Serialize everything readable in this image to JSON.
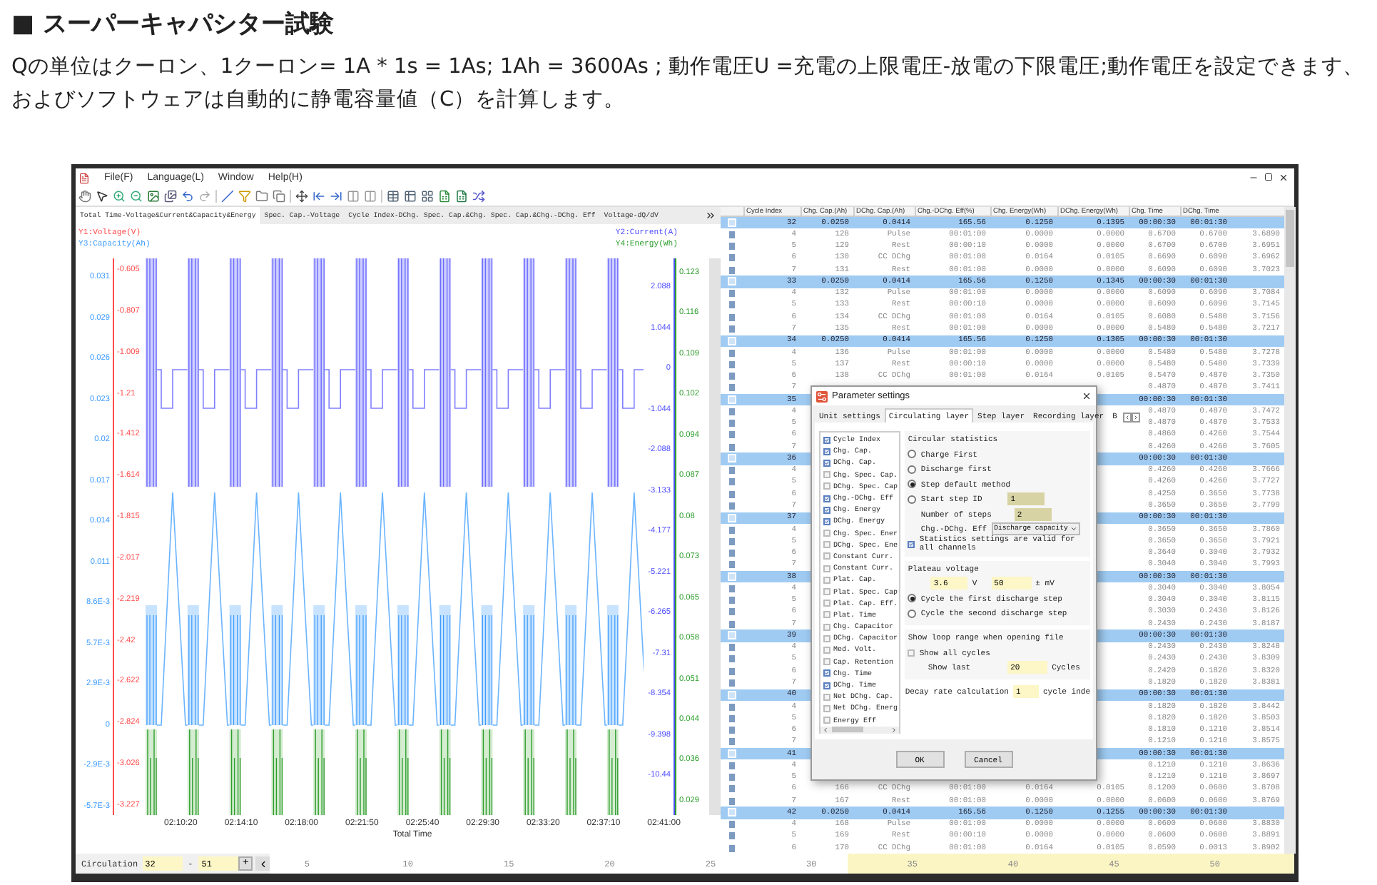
{
  "heading": "■ スーパーキャパシター試験",
  "paragraph": "Qの単位はクーロン、1クーロン= 1A * 1s = 1As; 1Ah = 3600As ; 動作電圧U =充電の上限電圧-放電の下限電圧;動作電圧を設定できます、およびソフトウェアは自動的に静電容量値（C）を計算します。",
  "menu": [
    "File(F)",
    "Language(L)",
    "Window",
    "Help(H)"
  ],
  "chart_tabs": [
    {
      "label": "Total Time-Voltage&Current&Capacity&Energy",
      "selected": true
    },
    {
      "label": "Spec. Cap.-Voltage",
      "selected": false
    },
    {
      "label": "Cycle Index-DChg. Spec. Cap.&Chg. Spec. Cap.&Chg.-DChg. Eff",
      "selected": false
    },
    {
      "label": "Voltage-dQ/dV",
      "selected": false
    }
  ],
  "chart": {
    "legend_left": [
      {
        "text": "Y1:Voltage(V)",
        "color": "#ff4d4d"
      },
      {
        "text": "Y3:Capacity(Ah)",
        "color": "#3d9bff"
      }
    ],
    "legend_right": [
      {
        "text": "Y2:Current(A)",
        "color": "#5050ff"
      },
      {
        "text": "Y4:Energy(Wh)",
        "color": "#2e9e2e"
      }
    ],
    "y3_ticks": [
      "0.031",
      "0.029",
      "0.026",
      "0.023",
      "0.02",
      "0.017",
      "0.014",
      "0.011",
      "8.6E-3",
      "5.7E-3",
      "2.9E-3",
      "0",
      "-2.9E-3",
      "-5.7E-3"
    ],
    "y1_ticks": [
      "-0.605",
      "-0.807",
      "-1.009",
      "-1.21",
      "-1.412",
      "-1.614",
      "-1.815",
      "-2.017",
      "-2.219",
      "-2.42",
      "-2.622",
      "-2.824",
      "-3.026",
      "-3.227"
    ],
    "y2_ticks": [
      "2.088",
      "1.044",
      "0",
      "-1.044",
      "-2.088",
      "-3.133",
      "-4.177",
      "-5.221",
      "-6.265",
      "-7.31",
      "-8.354",
      "-9.398",
      "-10.44"
    ],
    "y4_ticks": [
      "0.123",
      "0.116",
      "0.109",
      "0.102",
      "0.094",
      "0.087",
      "0.08",
      "0.073",
      "0.065",
      "0.058",
      "0.051",
      "0.044",
      "0.036",
      "0.029"
    ],
    "x_ticks": [
      "02:10:20",
      "02:14:10",
      "02:18:00",
      "02:21:50",
      "02:25:40",
      "02:29:30",
      "02:33:20",
      "02:37:10",
      "02:41:00"
    ],
    "x_title": "Total Time"
  },
  "table": {
    "columns": [
      "Cycle Index",
      "Chg. Cap.(Ah)",
      "DChg. Cap.(Ah)",
      "Chg.-DChg. Eff(%)",
      "Chg. Energy(Wh)",
      "DChg. Energy(Wh)",
      "Chg. Time",
      "DChg. Time"
    ],
    "rows": [
      {
        "kind": "cycle",
        "cells": [
          "32",
          "0.0250",
          "0.0414",
          "165.56",
          "0.1250",
          "0.1395",
          "00:00:30",
          "00:01:30"
        ]
      },
      {
        "kind": "step",
        "cells": [
          "4",
          "128",
          "Pulse",
          "00:01:00",
          "0.0000",
          "0.0000",
          "0.6700",
          "0.6700",
          "3.6890"
        ]
      },
      {
        "kind": "step",
        "cells": [
          "5",
          "129",
          "Rest",
          "00:00:10",
          "0.0000",
          "0.0000",
          "0.6700",
          "0.6700",
          "3.6951"
        ]
      },
      {
        "kind": "step",
        "cells": [
          "6",
          "130",
          "CC DChg",
          "00:01:00",
          "0.0164",
          "0.0105",
          "0.6690",
          "0.6090",
          "3.6962"
        ]
      },
      {
        "kind": "step",
        "cells": [
          "7",
          "131",
          "Rest",
          "00:01:00",
          "0.0000",
          "0.0000",
          "0.6090",
          "0.6090",
          "3.7023"
        ]
      },
      {
        "kind": "cycle",
        "cells": [
          "33",
          "0.0250",
          "0.0414",
          "165.56",
          "0.1250",
          "0.1345",
          "00:00:30",
          "00:01:30"
        ]
      },
      {
        "kind": "step",
        "cells": [
          "4",
          "132",
          "Pulse",
          "00:01:00",
          "0.0000",
          "0.0000",
          "0.6090",
          "0.6090",
          "3.7084"
        ]
      },
      {
        "kind": "step",
        "cells": [
          "5",
          "133",
          "Rest",
          "00:00:10",
          "0.0000",
          "0.0000",
          "0.6090",
          "0.6090",
          "3.7145"
        ]
      },
      {
        "kind": "step",
        "cells": [
          "6",
          "134",
          "CC DChg",
          "00:01:00",
          "0.0164",
          "0.0105",
          "0.6080",
          "0.5480",
          "3.7156"
        ]
      },
      {
        "kind": "step",
        "cells": [
          "7",
          "135",
          "Rest",
          "00:01:00",
          "0.0000",
          "0.0000",
          "0.5480",
          "0.5480",
          "3.7217"
        ]
      },
      {
        "kind": "cycle",
        "cells": [
          "34",
          "0.0250",
          "0.0414",
          "165.56",
          "0.1250",
          "0.1305",
          "00:00:30",
          "00:01:30"
        ]
      },
      {
        "kind": "step",
        "cells": [
          "4",
          "136",
          "Pulse",
          "00:01:00",
          "0.0000",
          "0.0000",
          "0.5480",
          "0.5480",
          "3.7278"
        ]
      },
      {
        "kind": "step",
        "cells": [
          "5",
          "137",
          "Rest",
          "00:00:10",
          "0.0000",
          "0.0000",
          "0.5480",
          "0.5480",
          "3.7339"
        ]
      },
      {
        "kind": "step",
        "cells": [
          "6",
          "138",
          "CC DChg",
          "00:01:00",
          "0.0164",
          "0.0105",
          "0.5470",
          "0.4870",
          "3.7350"
        ]
      },
      {
        "kind": "step",
        "cells": [
          "7",
          null,
          null,
          null,
          null,
          null,
          "0.4870",
          "0.4870",
          "3.7411"
        ]
      },
      {
        "kind": "cycle",
        "cells": [
          "35",
          null,
          null,
          null,
          null,
          null,
          "00:00:30",
          "00:01:30"
        ]
      },
      {
        "kind": "step",
        "cells": [
          "4",
          null,
          null,
          null,
          null,
          null,
          "0.4870",
          "0.4870",
          "3.7472"
        ]
      },
      {
        "kind": "step",
        "cells": [
          "5",
          null,
          null,
          null,
          null,
          null,
          "0.4870",
          "0.4870",
          "3.7533"
        ]
      },
      {
        "kind": "step",
        "cells": [
          "6",
          null,
          null,
          null,
          null,
          null,
          "0.4860",
          "0.4260",
          "3.7544"
        ]
      },
      {
        "kind": "step",
        "cells": [
          "7",
          null,
          null,
          null,
          null,
          null,
          "0.4260",
          "0.4260",
          "3.7605"
        ]
      },
      {
        "kind": "cycle",
        "cells": [
          "36",
          null,
          null,
          null,
          null,
          null,
          "00:00:30",
          "00:01:30"
        ]
      },
      {
        "kind": "step",
        "cells": [
          "4",
          null,
          null,
          null,
          null,
          null,
          "0.4260",
          "0.4260",
          "3.7666"
        ]
      },
      {
        "kind": "step",
        "cells": [
          "5",
          null,
          null,
          null,
          null,
          null,
          "0.4260",
          "0.4260",
          "3.7727"
        ]
      },
      {
        "kind": "step",
        "cells": [
          "6",
          null,
          null,
          null,
          null,
          null,
          "0.4250",
          "0.3650",
          "3.7738"
        ]
      },
      {
        "kind": "step",
        "cells": [
          "7",
          null,
          null,
          null,
          null,
          null,
          "0.3650",
          "0.3650",
          "3.7799"
        ]
      },
      {
        "kind": "cycle",
        "cells": [
          "37",
          null,
          null,
          null,
          null,
          null,
          "00:00:30",
          "00:01:30"
        ]
      },
      {
        "kind": "step",
        "cells": [
          "4",
          null,
          null,
          null,
          null,
          null,
          "0.3650",
          "0.3650",
          "3.7860"
        ]
      },
      {
        "kind": "step",
        "cells": [
          "5",
          null,
          null,
          null,
          null,
          null,
          "0.3650",
          "0.3650",
          "3.7921"
        ]
      },
      {
        "kind": "step",
        "cells": [
          "6",
          null,
          null,
          null,
          null,
          null,
          "0.3640",
          "0.3040",
          "3.7932"
        ]
      },
      {
        "kind": "step",
        "cells": [
          "7",
          null,
          null,
          null,
          null,
          null,
          "0.3040",
          "0.3040",
          "3.7993"
        ]
      },
      {
        "kind": "cycle",
        "cells": [
          "38",
          null,
          null,
          null,
          null,
          null,
          "00:00:30",
          "00:01:30"
        ]
      },
      {
        "kind": "step",
        "cells": [
          "4",
          null,
          null,
          null,
          null,
          null,
          "0.3040",
          "0.3040",
          "3.8054"
        ]
      },
      {
        "kind": "step",
        "cells": [
          "5",
          null,
          null,
          null,
          null,
          null,
          "0.3040",
          "0.3040",
          "3.8115"
        ]
      },
      {
        "kind": "step",
        "cells": [
          "6",
          null,
          null,
          null,
          null,
          null,
          "0.3030",
          "0.2430",
          "3.8126"
        ]
      },
      {
        "kind": "step",
        "cells": [
          "7",
          null,
          null,
          null,
          null,
          null,
          "0.2430",
          "0.2430",
          "3.8187"
        ]
      },
      {
        "kind": "cycle",
        "cells": [
          "39",
          null,
          null,
          null,
          null,
          null,
          "00:00:30",
          "00:01:30"
        ]
      },
      {
        "kind": "step",
        "cells": [
          "4",
          null,
          null,
          null,
          null,
          null,
          "0.2430",
          "0.2430",
          "3.8248"
        ]
      },
      {
        "kind": "step",
        "cells": [
          "5",
          null,
          null,
          null,
          null,
          null,
          "0.2430",
          "0.2430",
          "3.8309"
        ]
      },
      {
        "kind": "step",
        "cells": [
          "6",
          null,
          null,
          null,
          null,
          null,
          "0.2420",
          "0.1820",
          "3.8320"
        ]
      },
      {
        "kind": "step",
        "cells": [
          "7",
          null,
          null,
          null,
          null,
          null,
          "0.1820",
          "0.1820",
          "3.8381"
        ]
      },
      {
        "kind": "cycle",
        "cells": [
          "40",
          null,
          null,
          null,
          null,
          null,
          "00:00:30",
          "00:01:30"
        ]
      },
      {
        "kind": "step",
        "cells": [
          "4",
          null,
          null,
          null,
          null,
          null,
          "0.1820",
          "0.1820",
          "3.8442"
        ]
      },
      {
        "kind": "step",
        "cells": [
          "5",
          null,
          null,
          null,
          null,
          null,
          "0.1820",
          "0.1820",
          "3.8503"
        ]
      },
      {
        "kind": "step",
        "cells": [
          "6",
          null,
          null,
          null,
          null,
          null,
          "0.1810",
          "0.1210",
          "3.8514"
        ]
      },
      {
        "kind": "step",
        "cells": [
          "7",
          null,
          null,
          null,
          null,
          null,
          "0.1210",
          "0.1210",
          "3.8575"
        ]
      },
      {
        "kind": "cycle",
        "cells": [
          "41",
          null,
          null,
          null,
          null,
          null,
          "00:00:30",
          "00:01:30"
        ]
      },
      {
        "kind": "step",
        "cells": [
          "4",
          null,
          null,
          null,
          null,
          null,
          "0.1210",
          "0.1210",
          "3.8636"
        ]
      },
      {
        "kind": "step",
        "cells": [
          "5",
          null,
          null,
          null,
          null,
          null,
          "0.1210",
          "0.1210",
          "3.8697"
        ]
      },
      {
        "kind": "step",
        "cells": [
          "6",
          "166",
          "CC DChg",
          "00:01:00",
          "0.0164",
          "0.0105",
          "0.1200",
          "0.0600",
          "3.8708"
        ]
      },
      {
        "kind": "step",
        "cells": [
          "7",
          "167",
          "Rest",
          "00:01:00",
          "0.0000",
          "0.0000",
          "0.0600",
          "0.0600",
          "3.8769"
        ]
      },
      {
        "kind": "cycle",
        "cells": [
          "42",
          "0.0250",
          "0.0414",
          "165.56",
          "0.1250",
          "0.1255",
          "00:00:30",
          "00:01:30"
        ]
      },
      {
        "kind": "step",
        "cells": [
          "4",
          "168",
          "Pulse",
          "00:01:00",
          "0.0000",
          "0.0000",
          "0.0600",
          "0.0600",
          "3.8830"
        ]
      },
      {
        "kind": "step",
        "cells": [
          "5",
          "169",
          "Rest",
          "00:00:10",
          "0.0000",
          "0.0000",
          "0.0600",
          "0.0600",
          "3.8891"
        ]
      },
      {
        "kind": "step",
        "cells": [
          "6",
          "170",
          "CC DChg",
          "00:01:00",
          "0.0164",
          "0.0105",
          "0.0590",
          "0.0013",
          "3.8902"
        ]
      }
    ]
  },
  "dialog": {
    "title": "Parameter settings",
    "tabs": [
      {
        "label": "Unit settings",
        "selected": false
      },
      {
        "label": "Circulating layer",
        "selected": true
      },
      {
        "label": "Step layer",
        "selected": false
      },
      {
        "label": "Recording layer",
        "selected": false
      },
      {
        "label": "B",
        "selected": false
      }
    ],
    "columns": [
      {
        "label": "Cycle Index",
        "checked": true
      },
      {
        "label": "Chg. Cap.",
        "checked": true
      },
      {
        "label": "DChg. Cap.",
        "checked": true
      },
      {
        "label": "Chg. Spec. Cap.",
        "checked": false
      },
      {
        "label": "DChg. Spec. Cap",
        "checked": false
      },
      {
        "label": "Chg.-DChg. Eff",
        "checked": true
      },
      {
        "label": "Chg. Energy",
        "checked": true
      },
      {
        "label": "DChg. Energy",
        "checked": true
      },
      {
        "label": "Chg. Spec. Ener",
        "checked": false
      },
      {
        "label": "DChg. Spec. Ene",
        "checked": false
      },
      {
        "label": "Constant Curr.",
        "checked": false
      },
      {
        "label": "Constant Curr.",
        "checked": false
      },
      {
        "label": "Plat. Cap.",
        "checked": false
      },
      {
        "label": "Plat. Spec. Cap",
        "checked": false
      },
      {
        "label": "Plat. Cap. Eff.",
        "checked": false
      },
      {
        "label": "Plat. Time",
        "checked": false
      },
      {
        "label": "Chg. Capacitor",
        "checked": false
      },
      {
        "label": "DChg. Capacitor",
        "checked": false
      },
      {
        "label": "Med. Volt.",
        "checked": false
      },
      {
        "label": "Cap. Retention",
        "checked": false
      },
      {
        "label": "Chg. Time",
        "checked": true
      },
      {
        "label": "DChg. Time",
        "checked": true
      },
      {
        "label": "Net DChg. Cap.",
        "checked": false
      },
      {
        "label": "Net DChg. Energ",
        "checked": false
      },
      {
        "label": "Energy Eff",
        "checked": false
      }
    ],
    "stats_title": "Circular statistics",
    "stats_options": [
      {
        "label": "Charge First",
        "selected": false
      },
      {
        "label": "Discharge first",
        "selected": false
      },
      {
        "label": "Step default method",
        "selected": true
      },
      {
        "label": "Start step ID",
        "selected": false
      }
    ],
    "start_step": "1",
    "steps_label": "Number of steps",
    "steps": "2",
    "eff_label": "Chg.-DChg. Eff",
    "eff_value": "Discharge capacity",
    "valid_all": {
      "label": "Statistics settings are valid for all channels",
      "checked": true
    },
    "plateau_title": "Plateau voltage",
    "plateau_v": "3.6",
    "v_unit": "V",
    "plateau_mv": "50",
    "mv_unit": "± mV",
    "plateau_options": [
      {
        "label": "Cycle the first discharge step",
        "selected": true
      },
      {
        "label": "Cycle the second discharge step",
        "selected": false
      }
    ],
    "loop_title": "Show loop range when opening file",
    "show_all": {
      "label": "Show all cycles",
      "checked": false
    },
    "show_last_label": "Show last",
    "show_last": "20",
    "cycles_unit": "Cycles",
    "decay_label": "Decay rate calculation",
    "decay": "1",
    "decay_unit": "cycle inde",
    "buttons": [
      "OK",
      "Cancel"
    ]
  },
  "footer": {
    "label": "Circulation",
    "from": "32",
    "separator": "-",
    "to": "51",
    "add": "+",
    "scale": [
      "5",
      "10",
      "15",
      "20",
      "25",
      "30",
      "35",
      "40",
      "45",
      "50"
    ]
  }
}
